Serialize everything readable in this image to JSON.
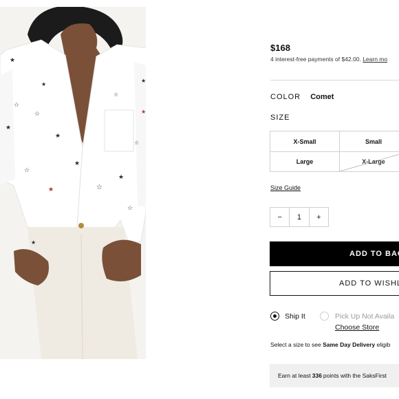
{
  "product": {
    "price": "$168",
    "installments_text": "4 interest-free payments of $42.00.",
    "learn_more": "Learn mo"
  },
  "color": {
    "label": "COLOR",
    "value": "Comet"
  },
  "size": {
    "label": "SIZE",
    "options": [
      "X-Small",
      "Small",
      "Large",
      "X-Large"
    ],
    "guide": "Size Guide"
  },
  "quantity": {
    "minus": "−",
    "value": "1",
    "plus": "+"
  },
  "buttons": {
    "add_to_bag": "ADD TO BAG",
    "add_to_wishlist": "ADD TO WISHLI"
  },
  "fulfillment": {
    "ship_it": "Ship It",
    "pickup": "Pick Up Not Availa",
    "choose_store": "Choose Store"
  },
  "delivery_note": {
    "prefix": "Select a size to see ",
    "bold": "Same Day Delivery",
    "suffix": " eligib"
  },
  "points": {
    "prefix": "Earn at least",
    "value": "336",
    "suffix": "points with the SaksFirst"
  }
}
